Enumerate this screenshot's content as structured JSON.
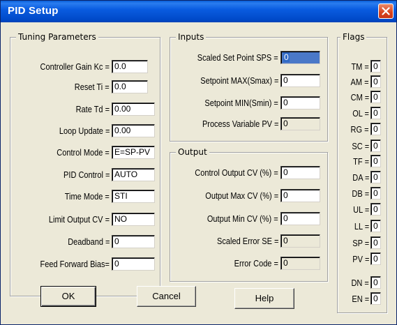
{
  "window": {
    "title": "PID Setup",
    "close_icon": "close-icon"
  },
  "tuning": {
    "label": "Tuning Parameters",
    "rows": [
      {
        "label": "Controller Gain Kc =",
        "value": "0.0"
      },
      {
        "label": "Reset Ti  =",
        "value": "0.0"
      },
      {
        "label": "Rate Td =",
        "value": "0.00"
      },
      {
        "label": "Loop Update =",
        "value": "0.00"
      },
      {
        "label": "Control Mode =",
        "value": "E=SP-PV"
      },
      {
        "label": "PID Control =",
        "value": "AUTO"
      },
      {
        "label": "Time Mode =",
        "value": "STI"
      },
      {
        "label": "Limit Output CV =",
        "value": "NO"
      },
      {
        "label": "Deadband =",
        "value": "0"
      },
      {
        "label": "Feed Forward Bias=",
        "value": "0"
      }
    ]
  },
  "inputs": {
    "label": "Inputs",
    "rows": [
      {
        "label": "Scaled Set Point SPS =",
        "value": "0"
      },
      {
        "label": "Setpoint MAX(Smax) =",
        "value": "0"
      },
      {
        "label": "Setpoint MIN(Smin) =",
        "value": "0"
      },
      {
        "label": "Process Variable PV =",
        "value": "0"
      }
    ]
  },
  "output": {
    "label": "Output",
    "rows": [
      {
        "label": "Control Output CV (%) =",
        "value": "0"
      },
      {
        "label": "Output Max     CV (%) =",
        "value": "0"
      },
      {
        "label": "Output Min     CV (%) =",
        "value": "0"
      },
      {
        "label": "Scaled Error SE =",
        "value": "0"
      },
      {
        "label": "Error Code =",
        "value": "0"
      }
    ]
  },
  "flags": {
    "label": "Flags",
    "rows": [
      {
        "label": "TM =",
        "value": "0"
      },
      {
        "label": "AM =",
        "value": "0"
      },
      {
        "label": "CM =",
        "value": "0"
      },
      {
        "label": "OL =",
        "value": "0"
      },
      {
        "label": "RG =",
        "value": "0"
      },
      {
        "label": "SC =",
        "value": "0"
      },
      {
        "label": "TF =",
        "value": "0"
      },
      {
        "label": "DA =",
        "value": "0"
      },
      {
        "label": "DB =",
        "value": "0"
      },
      {
        "label": "UL =",
        "value": "0"
      },
      {
        "label": "LL =",
        "value": "0"
      },
      {
        "label": "SP =",
        "value": "0"
      },
      {
        "label": "PV =",
        "value": "0"
      },
      {
        "label": "DN =",
        "value": "0"
      },
      {
        "label": "EN =",
        "value": "0"
      }
    ]
  },
  "buttons": {
    "ok": "OK",
    "cancel": "Cancel",
    "help": "Help"
  },
  "colors": {
    "titlebar": "#0a5ce0",
    "dialog_bg": "#ece9d8",
    "selection": "#316ac5",
    "close": "#d8421d"
  }
}
